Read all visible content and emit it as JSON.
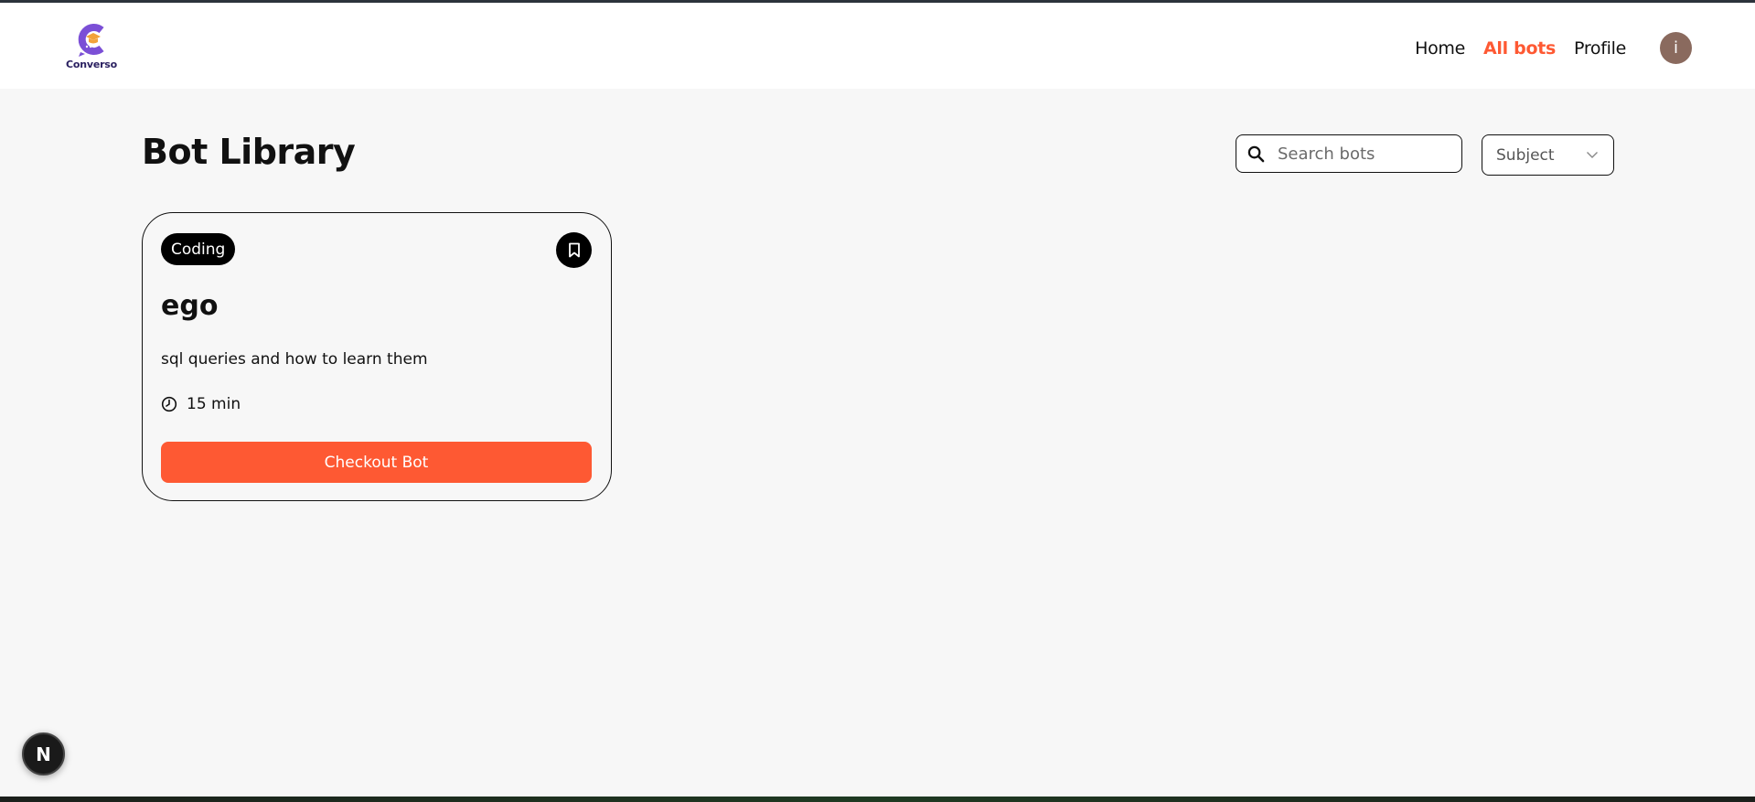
{
  "brand": {
    "name": "Converso",
    "colors": {
      "accent": "#fe5933",
      "logo_purple": "#7b4fd6"
    }
  },
  "nav": {
    "items": [
      {
        "label": "Home",
        "active": false
      },
      {
        "label": "All bots",
        "active": true
      },
      {
        "label": "Profile",
        "active": false
      }
    ]
  },
  "user": {
    "avatar_initial": "i"
  },
  "page": {
    "title": "Bot Library"
  },
  "search": {
    "placeholder": "Search bots",
    "value": ""
  },
  "filter": {
    "selected": "Subject"
  },
  "bots": [
    {
      "subject": "Coding",
      "name": "ego",
      "description": "sql queries and how to learn them",
      "duration": "15 min",
      "cta": "Checkout Bot"
    }
  ],
  "dev_indicator": {
    "label": "N"
  }
}
